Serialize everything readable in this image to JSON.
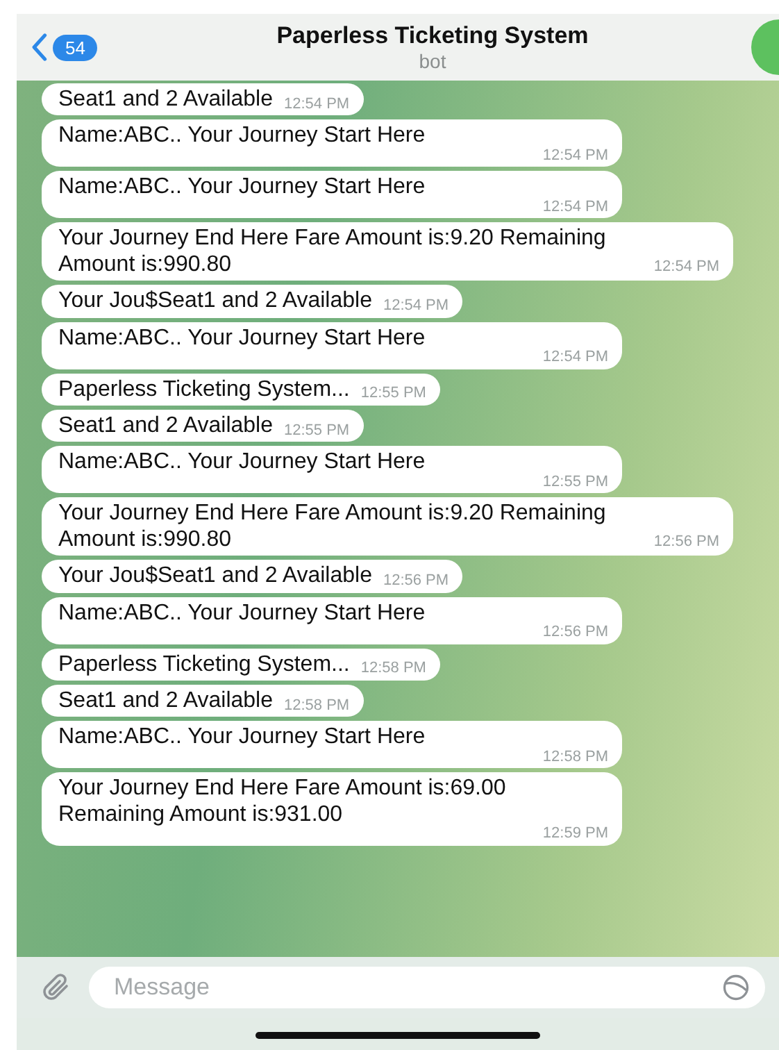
{
  "header": {
    "back_badge": "54",
    "title": "Paperless Ticketing System",
    "subtitle": "bot"
  },
  "messages": [
    {
      "kind": "inline",
      "text": "Seat1 and 2 Available",
      "time": "12:54 PM"
    },
    {
      "kind": "stacked",
      "text": "Name:ABC..  Your Journey Start Here",
      "time": "12:54 PM"
    },
    {
      "kind": "stacked",
      "text": "Name:ABC..  Your Journey Start Here",
      "time": "12:54 PM"
    },
    {
      "kind": "wrap",
      "text": "Your Journey End Here Fare Amount is:9.20 Remaining Amount is:990.80",
      "time": "12:54 PM"
    },
    {
      "kind": "inline",
      "text": "Your Jou$Seat1 and 2 Available",
      "time": "12:54 PM"
    },
    {
      "kind": "stacked",
      "text": "Name:ABC..  Your Journey Start Here",
      "time": "12:54 PM"
    },
    {
      "kind": "inline",
      "text": "Paperless Ticketing System...",
      "time": "12:55 PM"
    },
    {
      "kind": "inline",
      "text": "Seat1 and 2 Available",
      "time": "12:55 PM"
    },
    {
      "kind": "stacked",
      "text": "Name:ABC..  Your Journey Start Here",
      "time": "12:55 PM"
    },
    {
      "kind": "wrap",
      "text": "Your Journey End Here Fare Amount is:9.20 Remaining Amount is:990.80",
      "time": "12:56 PM"
    },
    {
      "kind": "inline",
      "text": "Your Jou$Seat1 and 2 Available",
      "time": "12:56 PM"
    },
    {
      "kind": "stacked",
      "text": "Name:ABC..  Your Journey Start Here",
      "time": "12:56 PM"
    },
    {
      "kind": "inline",
      "text": "Paperless Ticketing System...",
      "time": "12:58 PM"
    },
    {
      "kind": "inline",
      "text": "Seat1 and 2 Available",
      "time": "12:58 PM"
    },
    {
      "kind": "stacked",
      "text": "Name:ABC..  Your Journey Start Here",
      "time": "12:58 PM"
    },
    {
      "kind": "stacked",
      "text": "Your Journey End Here Fare Amount is:69.00 Remaining Amount is:931.00",
      "time": "12:59 PM"
    }
  ],
  "composer": {
    "placeholder": "Message"
  }
}
